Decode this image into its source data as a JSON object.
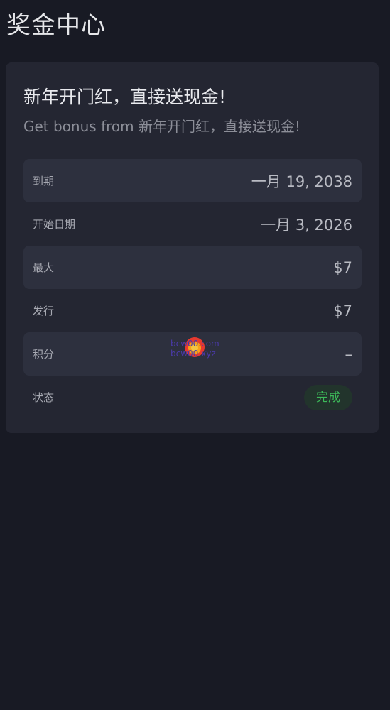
{
  "page": {
    "title": "奖金中心"
  },
  "bonus_card": {
    "title": "新年开门红，直接送现金!",
    "subtitle": "Get bonus from 新年开门红，直接送现金!",
    "rows": [
      {
        "label": "到期",
        "value": "一月 19, 2038"
      },
      {
        "label": "开始日期",
        "value": "一月 3, 2026"
      },
      {
        "label": "最大",
        "value": "$7"
      },
      {
        "label": "发行",
        "value": "$7"
      },
      {
        "label": "积分",
        "value": "–"
      },
      {
        "label": "状态",
        "value": "完成"
      }
    ]
  },
  "watermark": {
    "line1": "bcw00.com",
    "line2": "bcw00.xyz"
  },
  "colors": {
    "background": "#181a24",
    "card": "#242632",
    "row_shade": "#2d303e",
    "status_green": "#3dbb5a"
  }
}
